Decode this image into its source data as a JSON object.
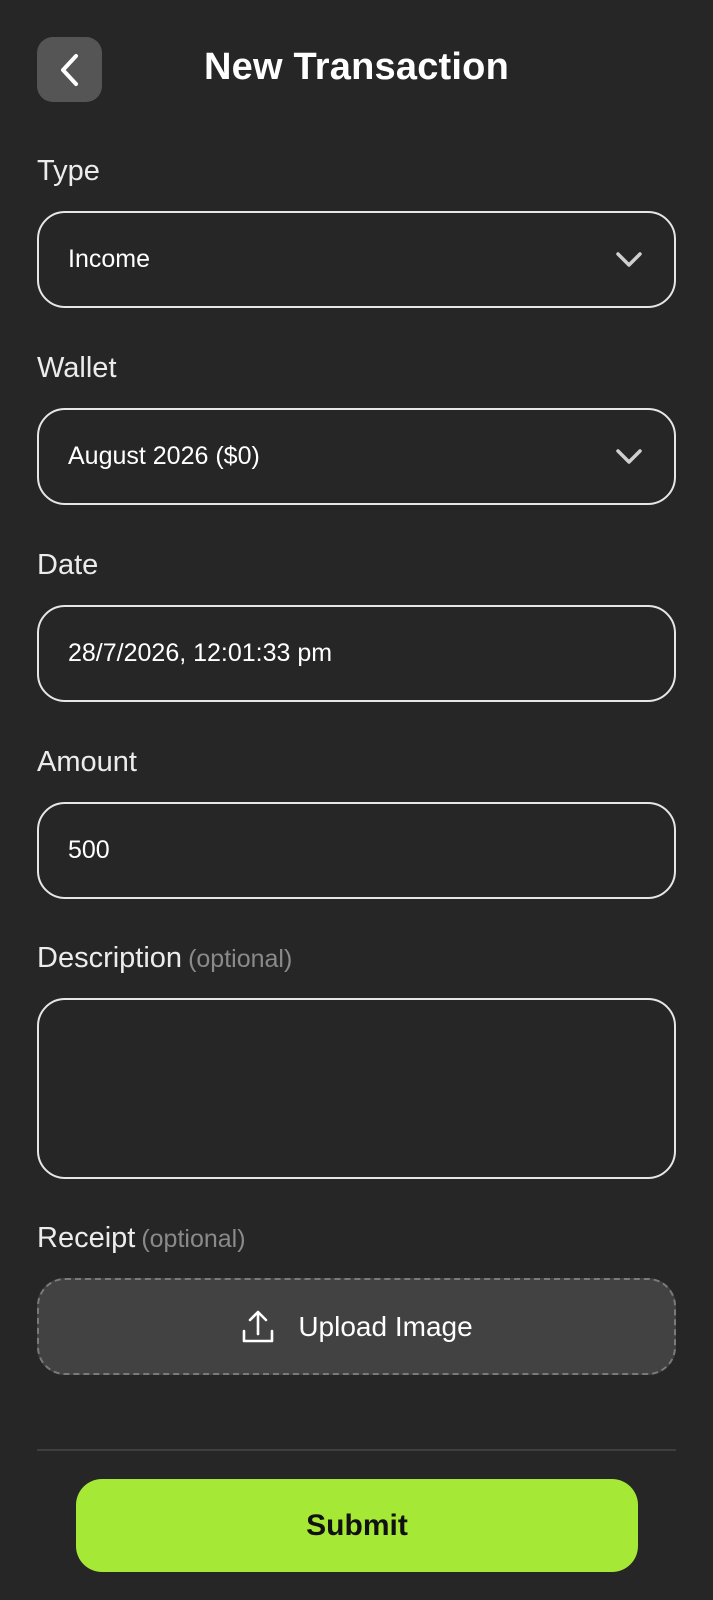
{
  "header": {
    "title": "New Transaction",
    "back_icon": "chevron-left-icon"
  },
  "form": {
    "type": {
      "label": "Type",
      "value": "Income",
      "icon": "chevron-down-icon"
    },
    "wallet": {
      "label": "Wallet",
      "value": "August 2026 ($0)",
      "icon": "chevron-down-icon"
    },
    "date": {
      "label": "Date",
      "value": "28/7/2026, 12:01:33 pm"
    },
    "amount": {
      "label": "Amount",
      "value": "500"
    },
    "description": {
      "label": "Description",
      "optional": "(optional)",
      "value": ""
    },
    "receipt": {
      "label": "Receipt",
      "optional": "(optional)",
      "upload_label": "Upload Image",
      "icon": "upload-icon"
    }
  },
  "footer": {
    "submit_label": "Submit"
  },
  "colors": {
    "background": "#262626",
    "accent": "#a5e936",
    "back_button": "#555555",
    "upload_bg": "#424242"
  }
}
